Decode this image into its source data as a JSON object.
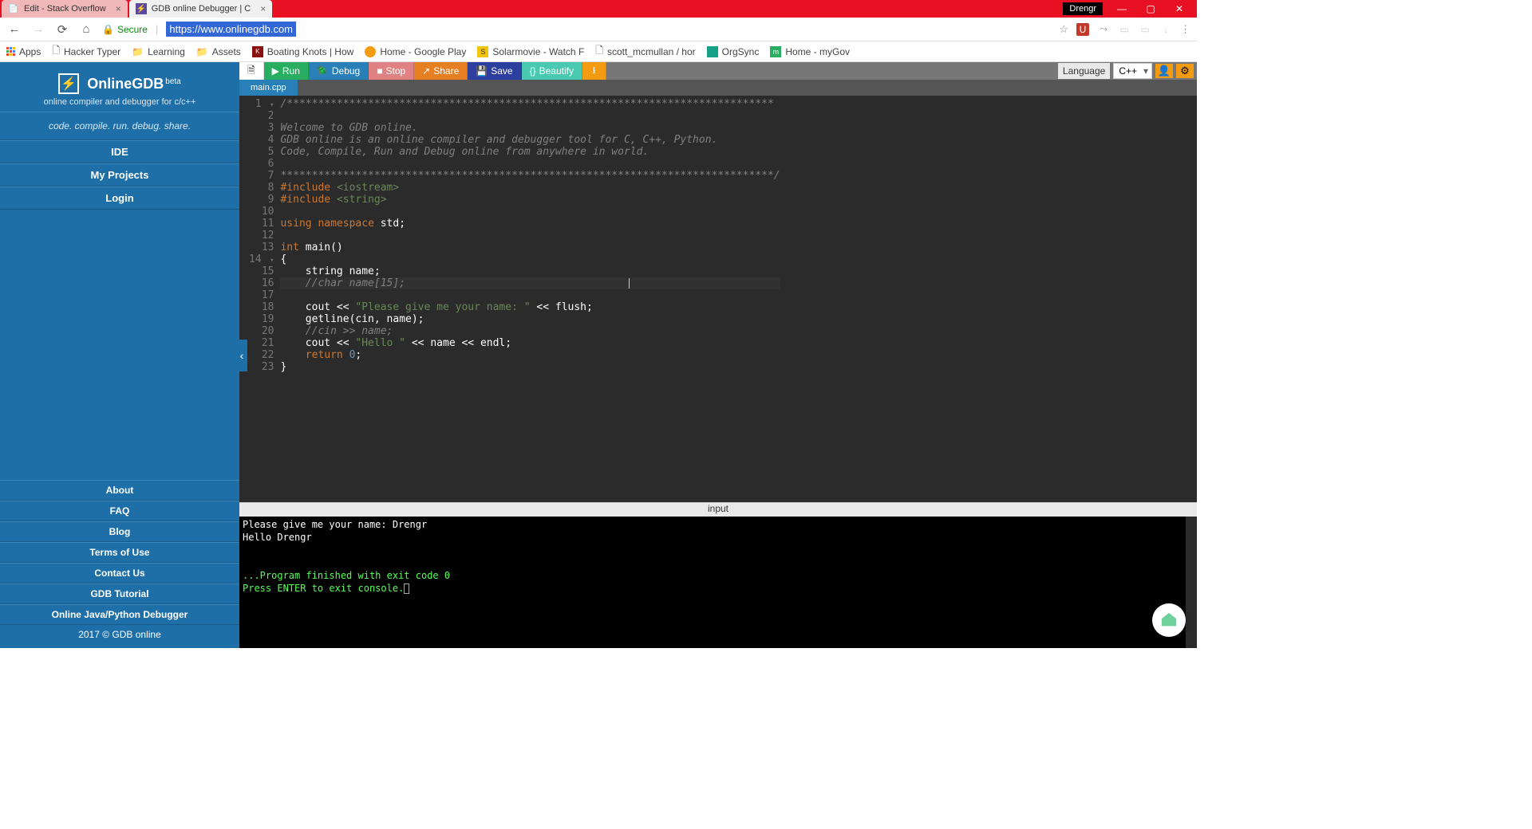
{
  "browser": {
    "tabs": [
      {
        "title": "Edit - Stack Overflow",
        "active": false
      },
      {
        "title": "GDB online Debugger | C",
        "active": true
      }
    ],
    "user_chip": "Drengr",
    "secure_label": "Secure",
    "url": "https://www.onlinegdb.com"
  },
  "bookmarks": {
    "apps": "Apps",
    "items": [
      "Hacker Typer",
      "Learning",
      "Assets",
      "Boating Knots | How",
      "Home - Google Play",
      "Solarmovie - Watch F",
      "scott_mcmullan / hor",
      "OrgSync",
      "Home - myGov"
    ]
  },
  "sidebar": {
    "brand": "OnlineGDB",
    "beta": "beta",
    "subtitle": "online compiler and debugger for c/c++",
    "tagline": "code. compile. run. debug. share.",
    "nav": [
      "IDE",
      "My Projects",
      "Login"
    ],
    "links": [
      "About",
      "FAQ",
      "Blog",
      "Terms of Use",
      "Contact Us",
      "GDB Tutorial",
      "Online Java/Python Debugger"
    ],
    "copyright": "2017 © GDB online"
  },
  "toolbar": {
    "run": "Run",
    "debug": "Debug",
    "stop": "Stop",
    "share": "Share",
    "save": "Save",
    "beautify": "Beautify",
    "language_label": "Language",
    "language_value": "C++"
  },
  "filetab": "main.cpp",
  "code": {
    "l1": "/******************************************************************************",
    "l3": "Welcome to GDB online.",
    "l4": "GDB online is an online compiler and debugger tool for C, C++, Python.",
    "l5": "Code, Compile, Run and Debug online from anywhere in world.",
    "l7": "*******************************************************************************/",
    "l8a": "#include ",
    "l8b": "<iostream>",
    "l9a": "#include ",
    "l9b": "<string>",
    "l11a": "using ",
    "l11b": "namespace ",
    "l11c": "std;",
    "l13a": "int ",
    "l13b": "main()",
    "l14": "{",
    "l15": "    string name;",
    "l16": "    //char name[15];",
    "l18a": "    cout << ",
    "l18b": "\"Please give me your name: \"",
    "l18c": " << flush;",
    "l19": "    getline(cin, name);",
    "l20": "    //cin >> name;",
    "l21a": "    cout << ",
    "l21b": "\"Hello \"",
    "l21c": " << name << endl;",
    "l22a": "    return ",
    "l22b": "0",
    "l22c": ";",
    "l23": "}"
  },
  "console": {
    "header": "input",
    "line1": "Please give me your name: Drengr",
    "line2": "Hello Drengr",
    "line3": "...Program finished with exit code 0",
    "line4": "Press ENTER to exit console."
  }
}
